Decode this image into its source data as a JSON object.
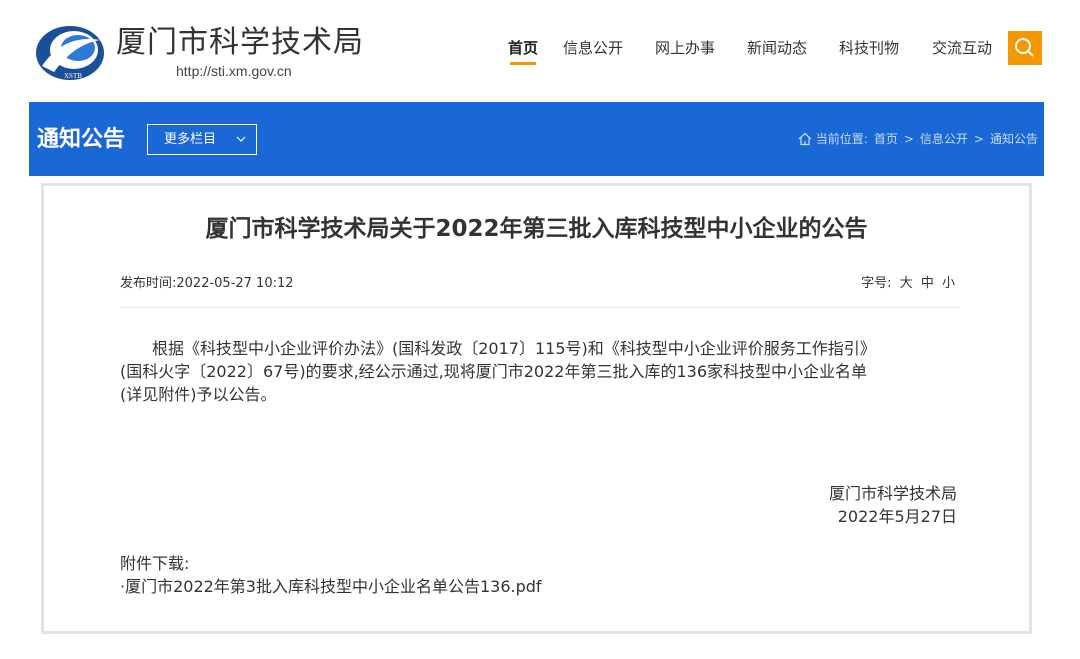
{
  "header": {
    "site_name": "厦门市科学技术局",
    "site_url": "http://sti.xm.gov.cn",
    "logo_text": "XSTB",
    "nav": [
      {
        "label": "首页",
        "active": true
      },
      {
        "label": "信息公开"
      },
      {
        "label": "网上办事"
      },
      {
        "label": "新闻动态"
      },
      {
        "label": "科技刊物"
      },
      {
        "label": "交流互动"
      }
    ],
    "search_icon": "search-icon"
  },
  "banner": {
    "title": "通知公告",
    "more_label": "更多栏目",
    "breadcrumb": {
      "prefix": "当前位置:",
      "items": [
        "首页",
        "信息公开",
        "通知公告"
      ],
      "separator": ">"
    }
  },
  "article": {
    "title": "厦门市科学技术局关于2022年第三批入库科技型中小企业的公告",
    "publish_time": "发布时间:2022-05-27 10:12",
    "font_size_label": "字号:",
    "font_sizes": [
      "大",
      "中",
      "小"
    ],
    "body_lines": [
      "根据《科技型中小企业评价办法》(国科发政〔2017〕115号)和《科技型中小企业评价服务工作指引》",
      "(国科火字〔2022〕67号)的要求,经公示通过,现将厦门市2022年第三批入库的136家科技型中小企业名单",
      "(详见附件)予以公告。"
    ],
    "signature_org": "厦门市科学技术局",
    "signature_date": "2022年5月27日",
    "attachment_label": "附件下载:",
    "attachment_link": "·厦门市2022年第3批入库科技型中小企业名单公告136.pdf"
  },
  "colors": {
    "brand_blue": "#1a68d6",
    "accent_orange": "#f39800",
    "panel_border": "#e3e3e3"
  }
}
